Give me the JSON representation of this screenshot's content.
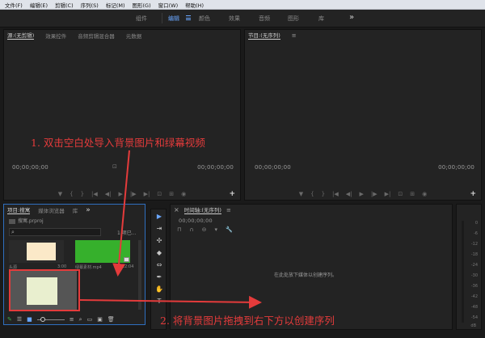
{
  "menu": [
    "文件(F)",
    "编辑(E)",
    "剪辑(C)",
    "序列(S)",
    "标记(M)",
    "图形(G)",
    "窗口(W)",
    "帮助(H)"
  ],
  "workspace_tabs": [
    "组件",
    "编辑",
    "颜色",
    "效果",
    "音频",
    "图形",
    "库"
  ],
  "workspace_active": "编辑",
  "workspace_more": "»",
  "source": {
    "tabs": [
      "源:(无剪辑)",
      "效果控件",
      "音频剪辑混合器",
      "元数据"
    ],
    "timecode_left": "00;00;00;00",
    "timecode_right": "00;00;00;00",
    "menu_icon": "≡",
    "tab_more": "»"
  },
  "program": {
    "tab": "节目:(无序列)",
    "timecode_left": "00;00;00;00",
    "timecode_right": "00;00;00;00",
    "menu_icon": "≡"
  },
  "transport_glyphs": [
    "▼",
    "{",
    "}",
    "|◀",
    "◀|",
    "▶",
    "|▶",
    "▶|",
    "⊡",
    "⊞",
    "◉"
  ],
  "add_button": "+",
  "project": {
    "tabs": [
      "项目:搜寓",
      "媒体浏览器",
      "库"
    ],
    "more": "»",
    "file": "搜寓.prproj",
    "items_selected": "1 项已...",
    "items": [
      {
        "name": "头源",
        "duration": "3:00"
      },
      {
        "name": "绿幕素材.mp4",
        "duration": "22:04"
      }
    ],
    "bottom_icons": [
      "pencil-icon",
      "list-view-icon",
      "icon-view-icon",
      "zoom-circle",
      "sort-icon",
      "search-icon",
      "folder-icon",
      "new-item-icon",
      "trash-icon"
    ]
  },
  "timeline": {
    "close": "×",
    "title": "时间轴:(无序列)",
    "menu_icon": "≡",
    "timecode": "00;00;00;00",
    "drop_hint": "在此处放下媒体以创建序列。"
  },
  "meter_scale": [
    "0",
    "-6",
    "-12",
    "-18",
    "-24",
    "-30",
    "-36",
    "-42",
    "-48",
    "-54"
  ],
  "meter_units": "dB",
  "annotations": {
    "step1": "1. 双击空白处导入背景图片和绿幕视频",
    "step2": "2. 将背景图片拖拽到右下方以创建序列"
  },
  "colors": {
    "accent": "#6aa7ff",
    "annotation": "#e43b3b",
    "cream_thumb": "#fbe9c8",
    "green_thumb": "#36b02c"
  }
}
